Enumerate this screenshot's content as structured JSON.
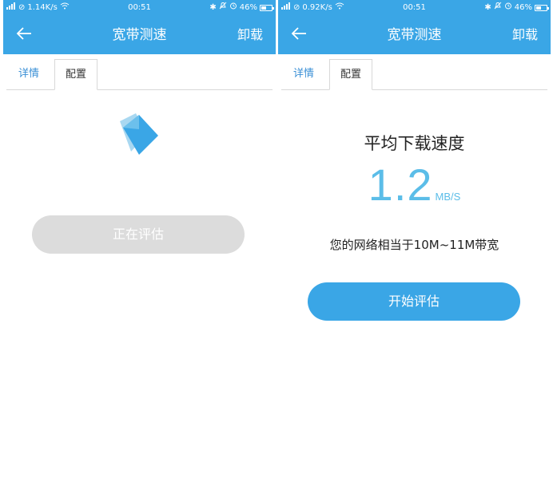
{
  "panels": [
    {
      "status_bar": {
        "network_speed": "1.14K/s",
        "time": "00:51",
        "battery_percent": "46%",
        "battery_level": 0.46
      },
      "app_bar": {
        "title": "宽带测速",
        "action_label": "卸载"
      },
      "tabs": [
        {
          "label": "详情",
          "active": false
        },
        {
          "label": "配置",
          "active": true
        }
      ],
      "button_label": "正在评估",
      "button_enabled": false
    },
    {
      "status_bar": {
        "network_speed": "0.92K/s",
        "time": "00:51",
        "battery_percent": "46%",
        "battery_level": 0.46
      },
      "app_bar": {
        "title": "宽带测速",
        "action_label": "卸载"
      },
      "tabs": [
        {
          "label": "详情",
          "active": false
        },
        {
          "label": "配置",
          "active": true
        }
      ],
      "result": {
        "title": "平均下载速度",
        "speed_value": "1.2",
        "speed_unit": "MB/S",
        "description": "您的网络相当于10M~11M带宽"
      },
      "button_label": "开始评估",
      "button_enabled": true
    }
  ],
  "colors": {
    "primary": "#3aa6e6",
    "tab_active_text": "#3a8fd6",
    "speed_text": "#5bbde8",
    "button_disabled": "#dcdcdc"
  },
  "icons": [
    "back-arrow-icon",
    "signal-icon",
    "data-saver-icon",
    "wifi-icon",
    "bluetooth-icon",
    "silent-icon",
    "alarm-icon",
    "battery-icon",
    "loading-icon"
  ]
}
